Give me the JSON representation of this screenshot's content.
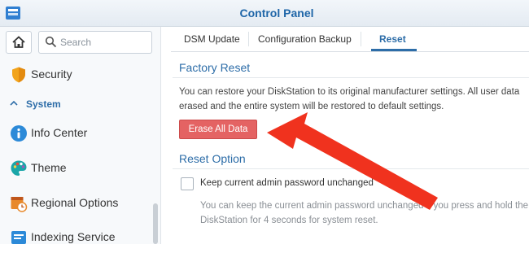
{
  "window": {
    "title": "Control Panel"
  },
  "sidebar": {
    "search_placeholder": "Search",
    "items": [
      {
        "label": "Security",
        "icon": "shield-icon"
      },
      {
        "label": "Info Center",
        "icon": "info-icon"
      },
      {
        "label": "Theme",
        "icon": "palette-icon"
      },
      {
        "label": "Regional Options",
        "icon": "calendar-clock-icon"
      },
      {
        "label": "Indexing Service",
        "icon": "indexing-icon"
      }
    ],
    "section": "System"
  },
  "tabs": [
    {
      "label": "DSM Update"
    },
    {
      "label": "Configuration Backup"
    },
    {
      "label": "Reset",
      "active": true
    }
  ],
  "factory_reset": {
    "title": "Factory Reset",
    "description_line1": "You can restore your DiskStation to its original manufacturer settings. All user data",
    "description_line2": "erased and the entire system will be restored to default settings.",
    "button_label": "Erase All Data"
  },
  "reset_option": {
    "title": "Reset Option",
    "checkbox_label": "Keep current admin password unchanged",
    "checkbox_checked": false,
    "note_line1": "You can keep the current admin password unchanged if you press and hold the",
    "note_line2": "DiskStation for 4 seconds for system reset."
  },
  "colors": {
    "accent": "#2d6da8",
    "erase_button": "#e46363",
    "annotation_arrow": "#f0321e"
  }
}
